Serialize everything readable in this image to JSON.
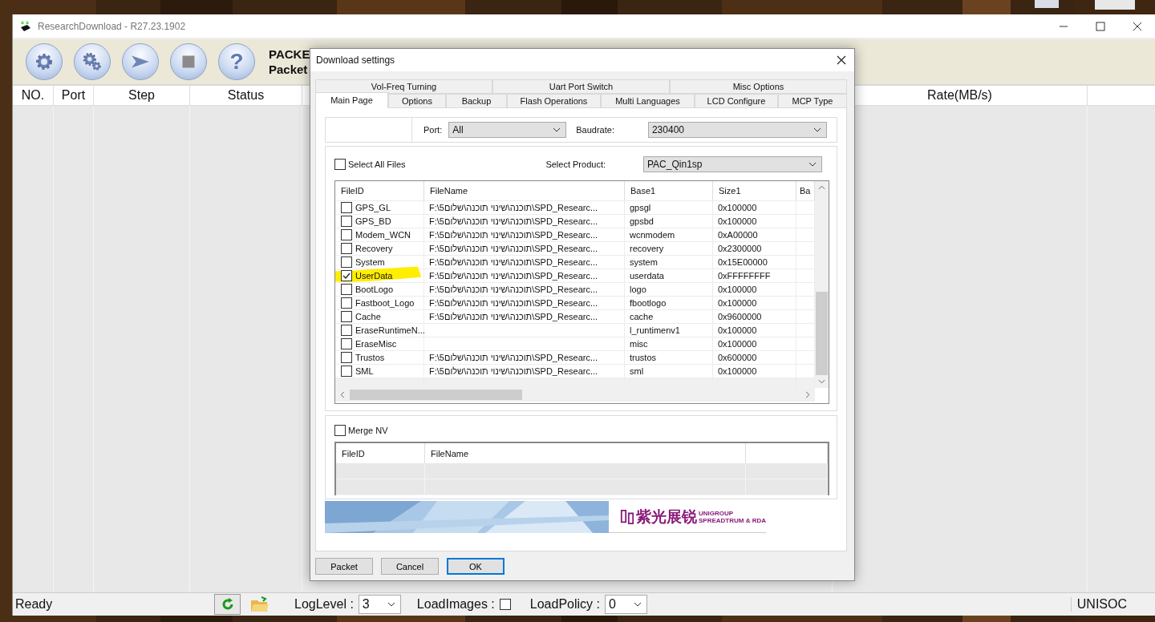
{
  "window": {
    "title": "ResearchDownload - R27.23.1902"
  },
  "toolbar": {
    "buttons": [
      {
        "kind": "settings"
      },
      {
        "kind": "gears"
      },
      {
        "kind": "start"
      },
      {
        "kind": "stop"
      },
      {
        "kind": "help",
        "label": "?"
      }
    ],
    "packet_title": "PACKE",
    "packet_subtitle": "Packet"
  },
  "grid": {
    "columns": [
      "NO.",
      "Port",
      "Step",
      "Status",
      "Rate(MB/s)"
    ]
  },
  "dialog": {
    "title": "Download settings",
    "tab_rows": [
      [
        {
          "label": "Vol-Freq Turning",
          "selected": false
        },
        {
          "label": "Uart Port Switch",
          "selected": false
        },
        {
          "label": "Misc Options",
          "selected": false
        }
      ],
      [
        {
          "label": "Main Page",
          "selected": true
        },
        {
          "label": "Options",
          "selected": false
        },
        {
          "label": "Backup",
          "selected": false
        },
        {
          "label": "Flash Operations",
          "selected": false
        },
        {
          "label": "Multi Languages",
          "selected": false
        },
        {
          "label": "LCD Configure",
          "selected": false
        },
        {
          "label": "MCP Type",
          "selected": false
        }
      ]
    ],
    "port": {
      "label": "Port:",
      "value": "All"
    },
    "baudrate": {
      "label": "Baudrate:",
      "value": "230400"
    },
    "select_all": {
      "label": "Select All Files",
      "checked": false
    },
    "product": {
      "label": "Select Product:",
      "value": "PAC_Qin1sp"
    },
    "files": {
      "columns": [
        "FileID",
        "FileName",
        "Base1",
        "Size1",
        "Ba"
      ],
      "rows": [
        {
          "checked": false,
          "highlighted": false,
          "file_id": "GPS_GL",
          "file_name": "F:\\תוכנה\\שינוי תוכנה\\שלום5\\SPD_Researc...",
          "base": "gpsgl",
          "size": "0x100000"
        },
        {
          "checked": false,
          "highlighted": false,
          "file_id": "GPS_BD",
          "file_name": "F:\\תוכנה\\שינוי תוכנה\\שלום5\\SPD_Researc...",
          "base": "gpsbd",
          "size": "0x100000"
        },
        {
          "checked": false,
          "highlighted": false,
          "file_id": "Modem_WCN",
          "file_name": "F:\\תוכנה\\שינוי תוכנה\\שלום5\\SPD_Researc...",
          "base": "wcnmodem",
          "size": "0xA00000"
        },
        {
          "checked": false,
          "highlighted": false,
          "file_id": "Recovery",
          "file_name": "F:\\תוכנה\\שינוי תוכנה\\שלום5\\SPD_Researc...",
          "base": "recovery",
          "size": "0x2300000"
        },
        {
          "checked": false,
          "highlighted": false,
          "file_id": "System",
          "file_name": "F:\\תוכנה\\שינוי תוכנה\\שלום5\\SPD_Researc...",
          "base": "system",
          "size": "0x15E00000"
        },
        {
          "checked": true,
          "highlighted": true,
          "file_id": "UserData",
          "file_name": "F:\\תוכנה\\שינוי תוכנה\\שלום5\\SPD_Researc...",
          "base": "userdata",
          "size": "0xFFFFFFFF"
        },
        {
          "checked": false,
          "highlighted": false,
          "file_id": "BootLogo",
          "file_name": "F:\\תוכנה\\שינוי תוכנה\\שלום5\\SPD_Researc...",
          "base": "logo",
          "size": "0x100000"
        },
        {
          "checked": false,
          "highlighted": false,
          "file_id": "Fastboot_Logo",
          "file_name": "F:\\תוכנה\\שינוי תוכנה\\שלום5\\SPD_Researc...",
          "base": "fbootlogo",
          "size": "0x100000"
        },
        {
          "checked": false,
          "highlighted": false,
          "file_id": "Cache",
          "file_name": "F:\\תוכנה\\שינוי תוכנה\\שלום5\\SPD_Researc...",
          "base": "cache",
          "size": "0x9600000"
        },
        {
          "checked": false,
          "highlighted": false,
          "file_id": "EraseRuntimeN...",
          "base": "l_runtimenv1",
          "size": "0x100000"
        },
        {
          "checked": false,
          "highlighted": false,
          "file_id": "EraseMisc",
          "base": "misc",
          "size": "0x100000"
        },
        {
          "checked": false,
          "highlighted": false,
          "file_id": "Trustos",
          "file_name": "F:\\תוכנה\\שינוי תוכנה\\שלום5\\SPD_Researc...",
          "base": "trustos",
          "size": "0x600000"
        },
        {
          "checked": false,
          "highlighted": false,
          "file_id": "SML",
          "file_name": "F:\\תוכנה\\שינוי תוכנה\\שלום5\\SPD_Researc...",
          "base": "sml",
          "size": "0x100000"
        }
      ]
    },
    "merge_nv": {
      "label": "Merge NV",
      "checked": false,
      "columns": [
        "FileID",
        "FileName"
      ]
    },
    "logo": {
      "name": "紫光展锐",
      "line_1": "UNIGROUP",
      "line_2": "SPREADTRUM & RDA"
    },
    "buttons": [
      {
        "label": "Packet",
        "default": false
      },
      {
        "label": "Cancel",
        "default": false
      },
      {
        "label": "OK",
        "default": true
      }
    ]
  },
  "status_bar": {
    "status": "Ready",
    "log_level": {
      "label": "LogLevel :",
      "value": "3"
    },
    "load_images": {
      "label": "LoadImages :",
      "checked": false
    },
    "load_policy": {
      "label": "LoadPolicy :",
      "value": "0"
    },
    "vendor": "UNISOC"
  }
}
